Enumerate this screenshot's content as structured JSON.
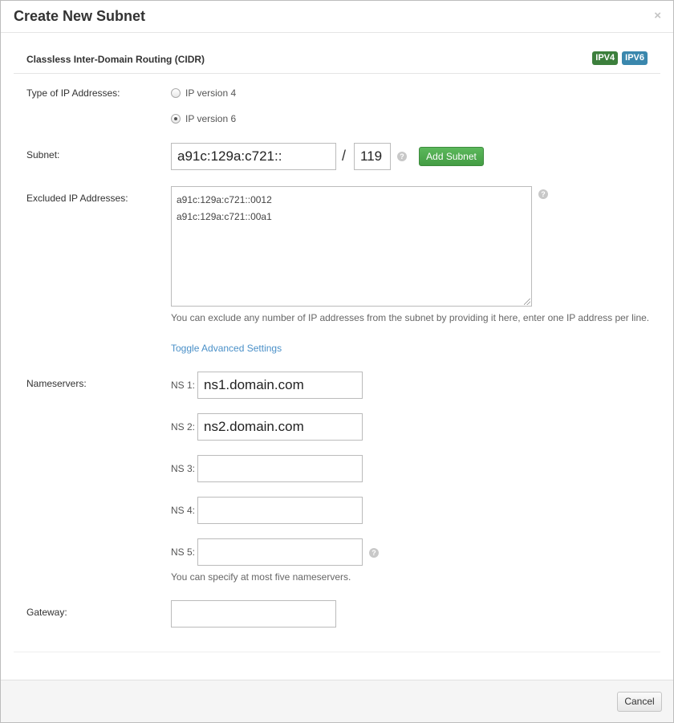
{
  "modal": {
    "title": "Create New Subnet",
    "close_glyph": "×"
  },
  "cidr": {
    "section_title": "Classless Inter-Domain Routing (CIDR)",
    "badges": [
      "IPV4",
      "IPV6"
    ]
  },
  "ip_type": {
    "label": "Type of IP Addresses:",
    "options": [
      {
        "label": "IP version 4",
        "checked": false
      },
      {
        "label": "IP version 6",
        "checked": true
      }
    ]
  },
  "subnet": {
    "label": "Subnet:",
    "address": "a91c:129a:c721::",
    "separator": "/",
    "prefix": "119",
    "help_glyph": "?",
    "add_button": "Add Subnet"
  },
  "excluded": {
    "label": "Excluded IP Addresses:",
    "lines": [
      "a91c:129a:c721::0012",
      "a91c:129a:c721::00a1"
    ],
    "hint": "You can exclude any number of IP addresses from the subnet by providing it here, enter one IP address per line.",
    "help_glyph": "?"
  },
  "advanced": {
    "toggle_link": "Toggle Advanced Settings"
  },
  "nameservers": {
    "label": "Nameservers:",
    "items": [
      {
        "label": "NS 1:",
        "value": "ns1.domain.com"
      },
      {
        "label": "NS 2:",
        "value": "ns2.domain.com"
      },
      {
        "label": "NS 3:",
        "value": ""
      },
      {
        "label": "NS 4:",
        "value": ""
      },
      {
        "label": "NS 5:",
        "value": ""
      }
    ],
    "hint": "You can specify at most five nameservers.",
    "help_glyph": "?"
  },
  "gateway": {
    "label": "Gateway:",
    "value": ""
  },
  "footer": {
    "cancel_button": "Cancel"
  },
  "colors": {
    "ipv4_badge": "#3c7f3c",
    "ipv6_badge": "#3a87ad",
    "add_button": "#5cb85c",
    "link": "#4a90c8"
  }
}
